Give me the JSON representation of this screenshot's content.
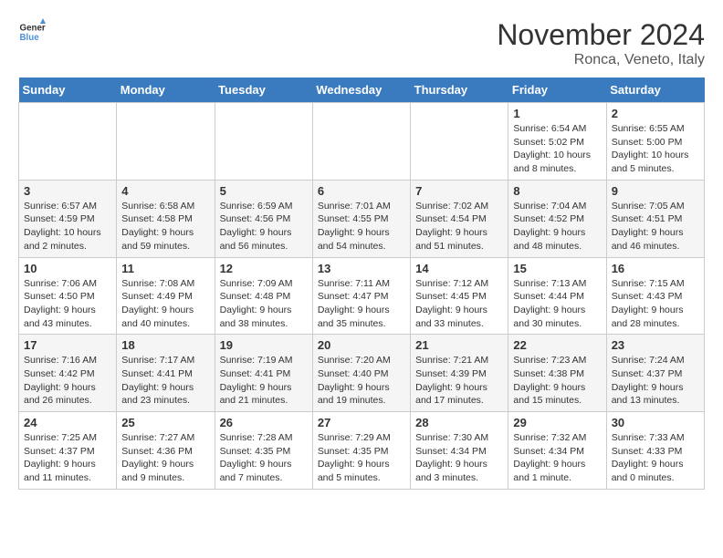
{
  "logo": {
    "line1": "General",
    "line2": "Blue"
  },
  "title": "November 2024",
  "location": "Ronca, Veneto, Italy",
  "days_header": [
    "Sunday",
    "Monday",
    "Tuesday",
    "Wednesday",
    "Thursday",
    "Friday",
    "Saturday"
  ],
  "weeks": [
    [
      {
        "day": "",
        "info": ""
      },
      {
        "day": "",
        "info": ""
      },
      {
        "day": "",
        "info": ""
      },
      {
        "day": "",
        "info": ""
      },
      {
        "day": "",
        "info": ""
      },
      {
        "day": "1",
        "info": "Sunrise: 6:54 AM\nSunset: 5:02 PM\nDaylight: 10 hours and 8 minutes."
      },
      {
        "day": "2",
        "info": "Sunrise: 6:55 AM\nSunset: 5:00 PM\nDaylight: 10 hours and 5 minutes."
      }
    ],
    [
      {
        "day": "3",
        "info": "Sunrise: 6:57 AM\nSunset: 4:59 PM\nDaylight: 10 hours and 2 minutes."
      },
      {
        "day": "4",
        "info": "Sunrise: 6:58 AM\nSunset: 4:58 PM\nDaylight: 9 hours and 59 minutes."
      },
      {
        "day": "5",
        "info": "Sunrise: 6:59 AM\nSunset: 4:56 PM\nDaylight: 9 hours and 56 minutes."
      },
      {
        "day": "6",
        "info": "Sunrise: 7:01 AM\nSunset: 4:55 PM\nDaylight: 9 hours and 54 minutes."
      },
      {
        "day": "7",
        "info": "Sunrise: 7:02 AM\nSunset: 4:54 PM\nDaylight: 9 hours and 51 minutes."
      },
      {
        "day": "8",
        "info": "Sunrise: 7:04 AM\nSunset: 4:52 PM\nDaylight: 9 hours and 48 minutes."
      },
      {
        "day": "9",
        "info": "Sunrise: 7:05 AM\nSunset: 4:51 PM\nDaylight: 9 hours and 46 minutes."
      }
    ],
    [
      {
        "day": "10",
        "info": "Sunrise: 7:06 AM\nSunset: 4:50 PM\nDaylight: 9 hours and 43 minutes."
      },
      {
        "day": "11",
        "info": "Sunrise: 7:08 AM\nSunset: 4:49 PM\nDaylight: 9 hours and 40 minutes."
      },
      {
        "day": "12",
        "info": "Sunrise: 7:09 AM\nSunset: 4:48 PM\nDaylight: 9 hours and 38 minutes."
      },
      {
        "day": "13",
        "info": "Sunrise: 7:11 AM\nSunset: 4:47 PM\nDaylight: 9 hours and 35 minutes."
      },
      {
        "day": "14",
        "info": "Sunrise: 7:12 AM\nSunset: 4:45 PM\nDaylight: 9 hours and 33 minutes."
      },
      {
        "day": "15",
        "info": "Sunrise: 7:13 AM\nSunset: 4:44 PM\nDaylight: 9 hours and 30 minutes."
      },
      {
        "day": "16",
        "info": "Sunrise: 7:15 AM\nSunset: 4:43 PM\nDaylight: 9 hours and 28 minutes."
      }
    ],
    [
      {
        "day": "17",
        "info": "Sunrise: 7:16 AM\nSunset: 4:42 PM\nDaylight: 9 hours and 26 minutes."
      },
      {
        "day": "18",
        "info": "Sunrise: 7:17 AM\nSunset: 4:41 PM\nDaylight: 9 hours and 23 minutes."
      },
      {
        "day": "19",
        "info": "Sunrise: 7:19 AM\nSunset: 4:41 PM\nDaylight: 9 hours and 21 minutes."
      },
      {
        "day": "20",
        "info": "Sunrise: 7:20 AM\nSunset: 4:40 PM\nDaylight: 9 hours and 19 minutes."
      },
      {
        "day": "21",
        "info": "Sunrise: 7:21 AM\nSunset: 4:39 PM\nDaylight: 9 hours and 17 minutes."
      },
      {
        "day": "22",
        "info": "Sunrise: 7:23 AM\nSunset: 4:38 PM\nDaylight: 9 hours and 15 minutes."
      },
      {
        "day": "23",
        "info": "Sunrise: 7:24 AM\nSunset: 4:37 PM\nDaylight: 9 hours and 13 minutes."
      }
    ],
    [
      {
        "day": "24",
        "info": "Sunrise: 7:25 AM\nSunset: 4:37 PM\nDaylight: 9 hours and 11 minutes."
      },
      {
        "day": "25",
        "info": "Sunrise: 7:27 AM\nSunset: 4:36 PM\nDaylight: 9 hours and 9 minutes."
      },
      {
        "day": "26",
        "info": "Sunrise: 7:28 AM\nSunset: 4:35 PM\nDaylight: 9 hours and 7 minutes."
      },
      {
        "day": "27",
        "info": "Sunrise: 7:29 AM\nSunset: 4:35 PM\nDaylight: 9 hours and 5 minutes."
      },
      {
        "day": "28",
        "info": "Sunrise: 7:30 AM\nSunset: 4:34 PM\nDaylight: 9 hours and 3 minutes."
      },
      {
        "day": "29",
        "info": "Sunrise: 7:32 AM\nSunset: 4:34 PM\nDaylight: 9 hours and 1 minute."
      },
      {
        "day": "30",
        "info": "Sunrise: 7:33 AM\nSunset: 4:33 PM\nDaylight: 9 hours and 0 minutes."
      }
    ]
  ]
}
